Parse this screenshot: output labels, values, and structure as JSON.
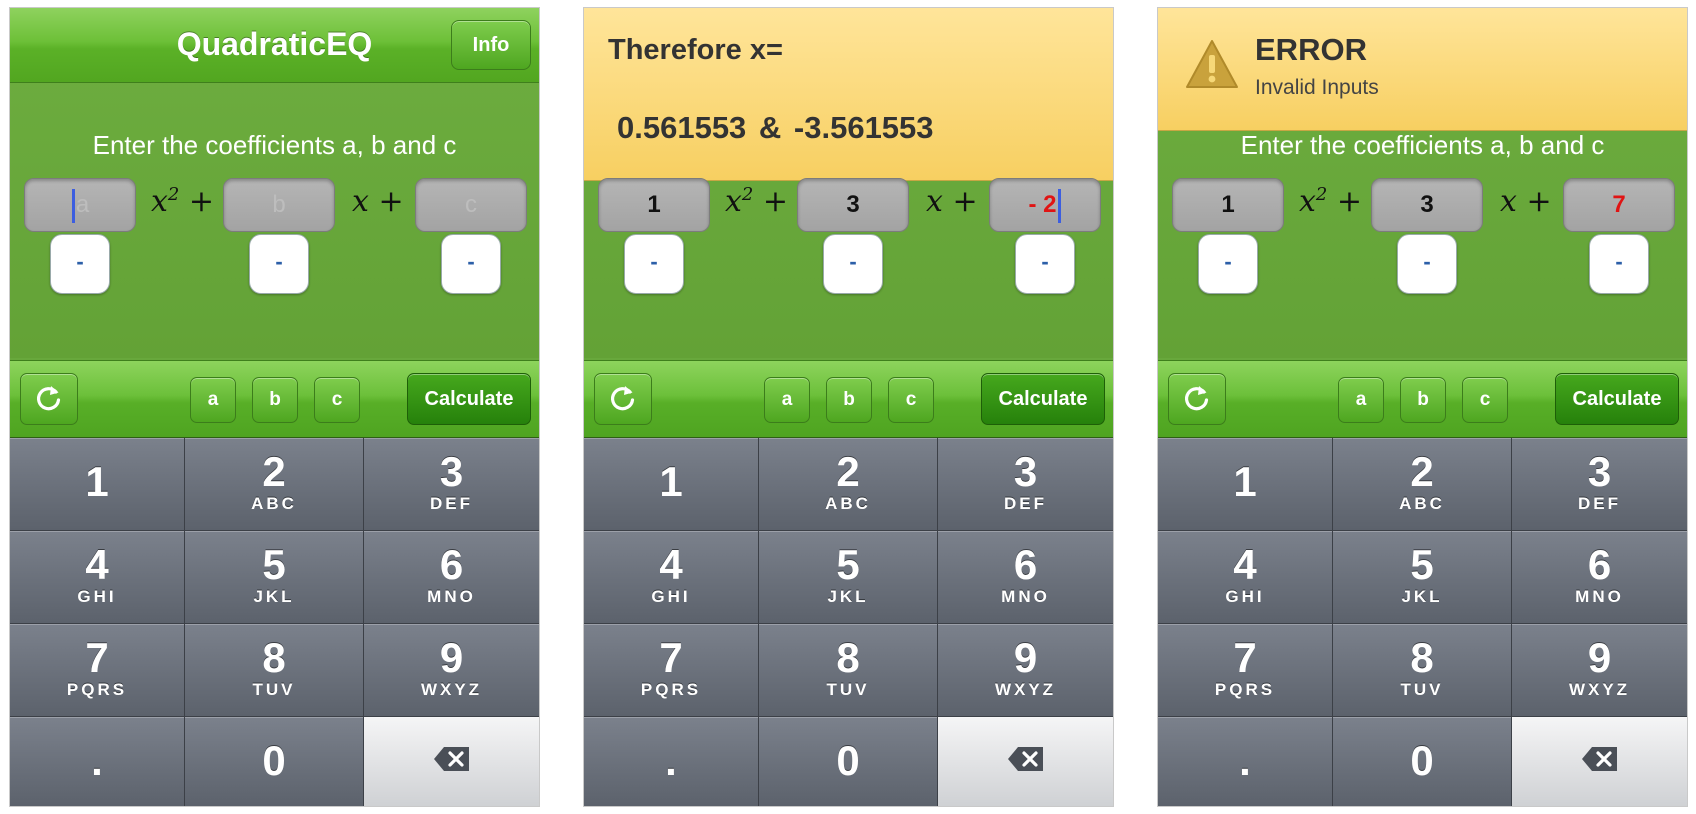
{
  "screens": [
    {
      "nav": {
        "title": "QuadraticEQ",
        "info_label": "Info"
      },
      "prompt": "Enter the coefficients a, b and c",
      "coefficients": {
        "a_placeholder": "a",
        "b_placeholder": "b",
        "c_placeholder": "c"
      }
    },
    {
      "result": {
        "title": "Therefore x=",
        "values": "0.561553  &  -3.561553"
      },
      "coefficients": {
        "a": "1",
        "b": "3",
        "c": "- 2"
      }
    },
    {
      "alert": {
        "title": "ERROR",
        "message": "Invalid Inputs"
      },
      "prompt": "Enter the coefficients a, b and c",
      "coefficients": {
        "a": "1",
        "b": "3",
        "c": "7"
      }
    }
  ],
  "equation": {
    "x_term": "x",
    "sq_exp": "2",
    "plus": "+"
  },
  "negate_label": "-",
  "toolbar": {
    "refresh_icon": "refresh-icon",
    "a_label": "a",
    "b_label": "b",
    "c_label": "c",
    "calculate_label": "Calculate"
  },
  "keypad": {
    "keys": [
      {
        "num": "1",
        "letters": ""
      },
      {
        "num": "2",
        "letters": "ABC"
      },
      {
        "num": "3",
        "letters": "DEF"
      },
      {
        "num": "4",
        "letters": "GHI"
      },
      {
        "num": "5",
        "letters": "JKL"
      },
      {
        "num": "6",
        "letters": "MNO"
      },
      {
        "num": "7",
        "letters": "PQRS"
      },
      {
        "num": "8",
        "letters": "TUV"
      },
      {
        "num": "9",
        "letters": "WXYZ"
      },
      {
        "num": ".",
        "letters": ""
      },
      {
        "num": "0",
        "letters": ""
      }
    ],
    "delete_icon": "backspace-icon"
  },
  "colors": {
    "app_green": "#68a83c",
    "bar_green": "#6cc03a",
    "banner_yellow": "#f7cf61",
    "input_red": "#e01414",
    "caret_blue": "#3c5ee0"
  }
}
